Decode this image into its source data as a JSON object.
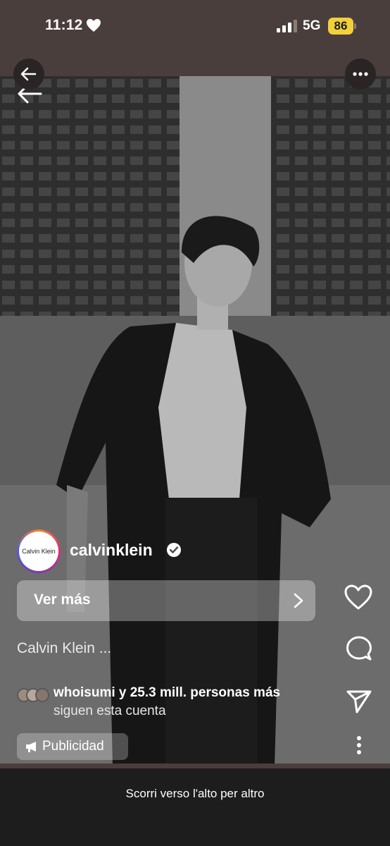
{
  "status_bar": {
    "time": "11:12",
    "network": "5G",
    "battery": "86",
    "battery_color": "#f2d03a"
  },
  "reel": {
    "account": {
      "avatar_text": "Calvin Klein",
      "username": "calvinklein",
      "verified": true
    },
    "cta_label": "Ver más",
    "caption": "Calvin Klein ...",
    "followers": {
      "line1": "whoisumi y 25.3 mill. personas más",
      "line2": "siguen esta cuenta"
    },
    "ad_label": "Publicidad",
    "icons": [
      "back-arrow-icon",
      "more-options-icon",
      "heart-icon",
      "comment-icon",
      "share-icon",
      "megaphone-icon",
      "verified-badge-icon",
      "chevron-right-icon"
    ]
  },
  "bottom_bar": {
    "hint": "Scorri verso l'alto per altro"
  }
}
